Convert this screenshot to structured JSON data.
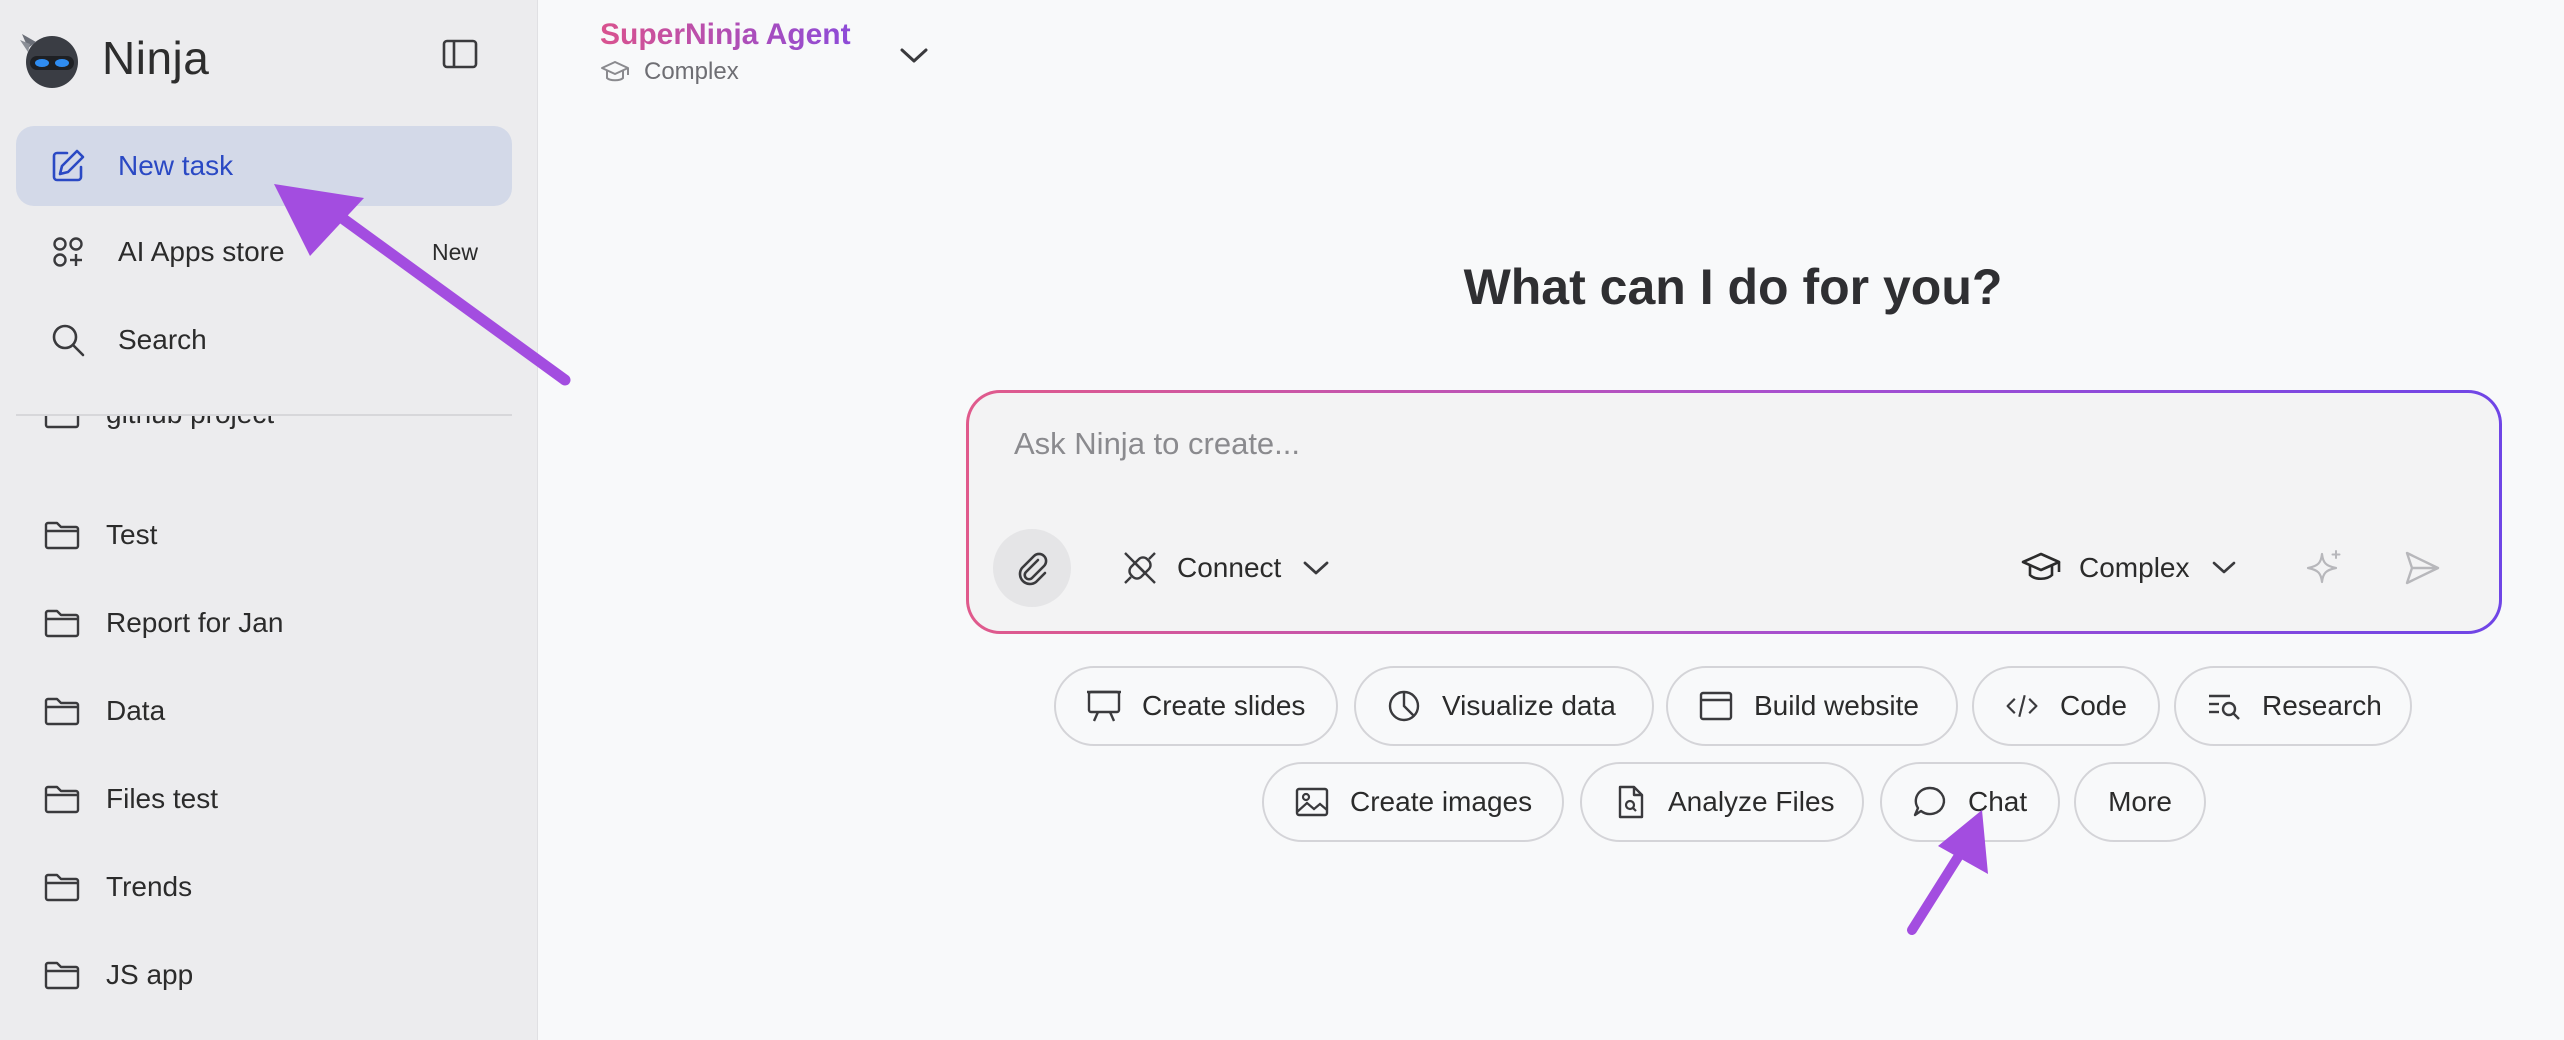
{
  "app": {
    "name": "Ninja"
  },
  "sidebar": {
    "nav": [
      {
        "label": "New task",
        "icon": "edit-icon",
        "active": true
      },
      {
        "label": "AI Apps store",
        "icon": "apps-icon",
        "badge": "New"
      },
      {
        "label": "Search",
        "icon": "search-icon"
      }
    ],
    "folders": [
      "github project",
      "Test",
      "Report for Jan",
      "Data",
      "Files test",
      "Trends",
      "JS app"
    ]
  },
  "agent": {
    "title": "SuperNinja Agent",
    "mode": "Complex"
  },
  "main": {
    "heading": "What can I do for you?",
    "composer": {
      "placeholder": "Ask Ninja to create...",
      "connect_label": "Connect",
      "mode_label": "Complex"
    },
    "suggestions_row1": [
      "Create slides",
      "Visualize data",
      "Build website",
      "Code",
      "Research"
    ],
    "suggestions_row2": [
      "Create images",
      "Analyze Files",
      "Chat",
      "More"
    ]
  },
  "colors": {
    "accent_blue": "#2a49c4",
    "active_bg": "#d3d9e8",
    "gradient_start": "#e05a8c",
    "gradient_end": "#6f45e6",
    "annotation_arrow": "#a34de0"
  }
}
